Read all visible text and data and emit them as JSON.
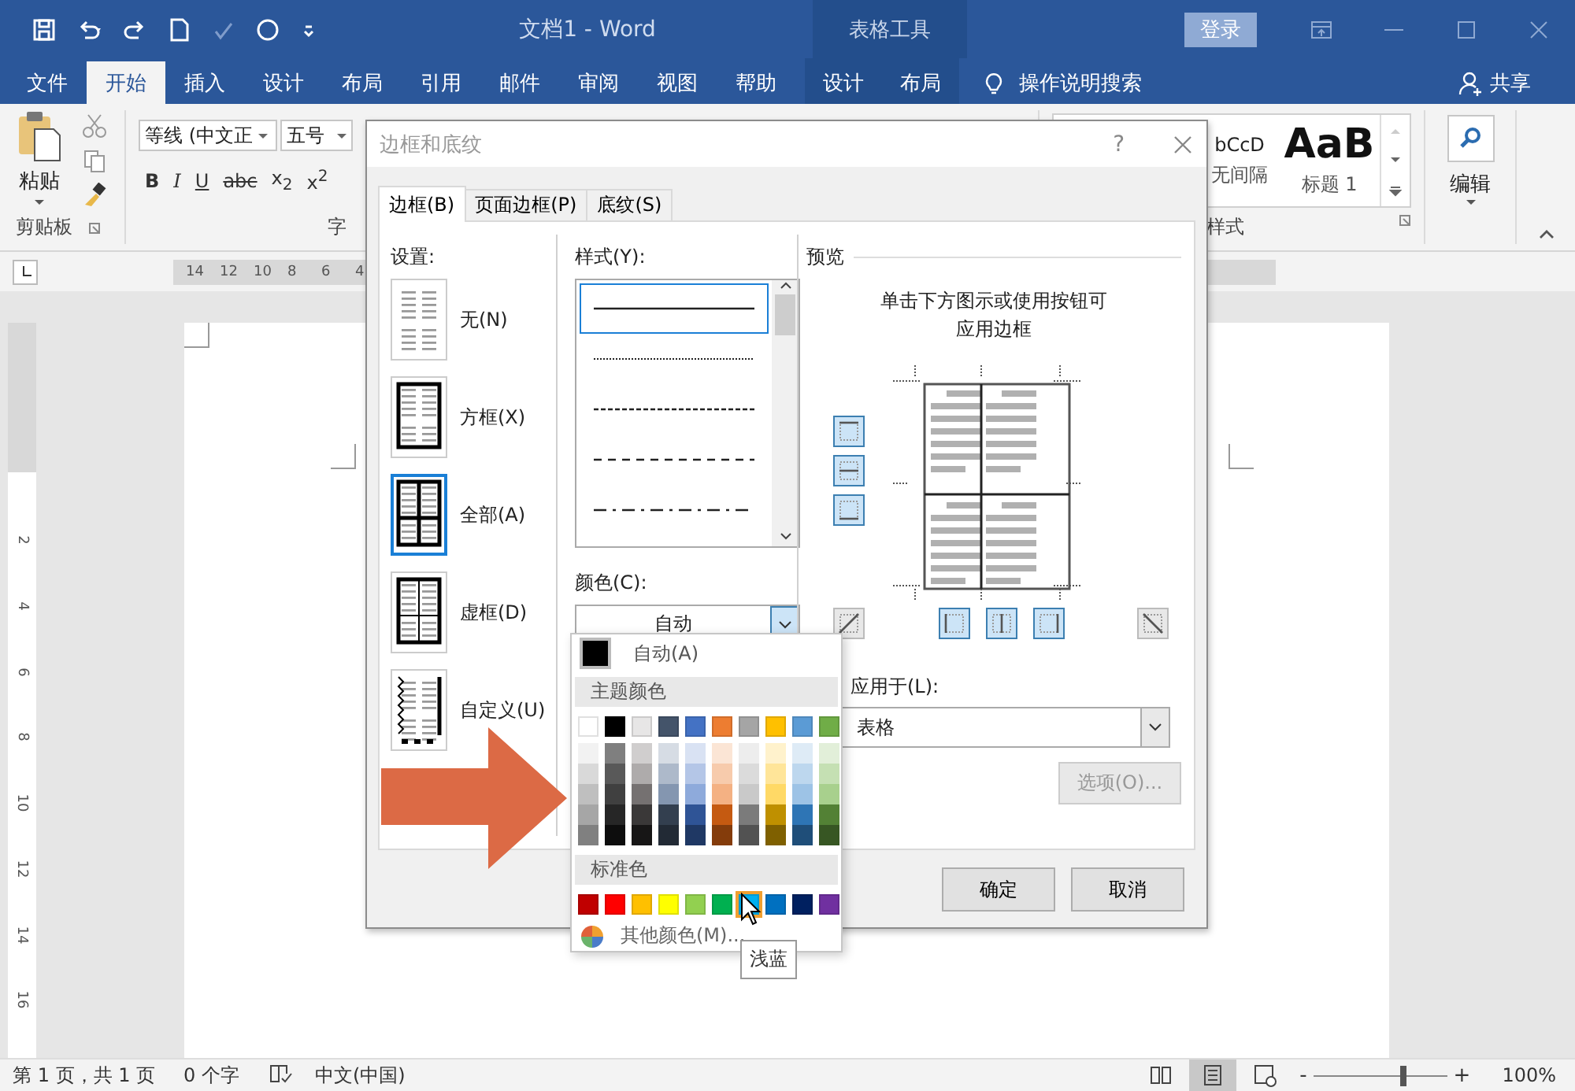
{
  "window": {
    "title": "文档1 - Word",
    "context_group": "表格工具",
    "sign_in": "登录"
  },
  "ribbon_tabs": [
    {
      "label": "文件",
      "selected": false
    },
    {
      "label": "开始",
      "selected": true
    },
    {
      "label": "插入",
      "selected": false
    },
    {
      "label": "设计",
      "selected": false
    },
    {
      "label": "布局",
      "selected": false
    },
    {
      "label": "引用",
      "selected": false
    },
    {
      "label": "邮件",
      "selected": false
    },
    {
      "label": "审阅",
      "selected": false
    },
    {
      "label": "视图",
      "selected": false
    },
    {
      "label": "帮助",
      "selected": false
    }
  ],
  "context_tabs": [
    {
      "label": "设计",
      "selected": false
    },
    {
      "label": "布局",
      "selected": false
    }
  ],
  "tell_me": "操作说明搜索",
  "share": "共享",
  "clipboard": {
    "paste": "粘贴",
    "group": "剪贴板"
  },
  "font": {
    "name": "等线 (中文正",
    "size": "五号",
    "group": "字",
    "buttons": [
      {
        "kind": "bold",
        "label": "B"
      },
      {
        "kind": "italic",
        "label": "I"
      },
      {
        "kind": "underline",
        "label": "U"
      },
      {
        "kind": "strike",
        "label": "abc"
      },
      {
        "kind": "script",
        "label": "x$_{2}$"
      },
      {
        "kind": "script",
        "label": "x$^{2}$"
      }
    ]
  },
  "styles": {
    "items": [
      {
        "preview": "bCcD",
        "label": "无间隔",
        "kind": "normal"
      },
      {
        "preview": "AaB",
        "label": "标题 1",
        "kind": "heading"
      }
    ],
    "group": "样式"
  },
  "editing": {
    "label": "编辑"
  },
  "ruler": {
    "labels": [
      "14",
      "12",
      "10",
      "8",
      "6",
      "4"
    ]
  },
  "vertical_ruler": {
    "labels": [
      "2",
      "4",
      "6",
      "8",
      "10",
      "12",
      "14",
      "16"
    ]
  },
  "dialog": {
    "title": "边框和底纹",
    "help": "?",
    "tabs": [
      {
        "label": "边框(B)",
        "selected": true
      },
      {
        "label": "页面边框(P)",
        "selected": false
      },
      {
        "label": "底纹(S)",
        "selected": false
      }
    ],
    "settings_label": "设置:",
    "settings": [
      {
        "kind": "none",
        "label": "无(N)",
        "selected": false
      },
      {
        "kind": "box",
        "label": "方框(X)",
        "selected": false
      },
      {
        "kind": "all",
        "label": "全部(A)",
        "selected": true
      },
      {
        "kind": "grid",
        "label": "虚框(D)",
        "selected": false
      },
      {
        "kind": "custom",
        "label": "自定义(U)",
        "selected": false
      }
    ],
    "style_label": "样式(Y):",
    "line_styles": [
      {
        "kind": "solid",
        "selected": true
      },
      {
        "kind": "dotted",
        "selected": false
      },
      {
        "kind": "dashed-fine",
        "selected": false
      },
      {
        "kind": "dashed",
        "selected": false
      },
      {
        "kind": "dash-dot",
        "selected": false
      }
    ],
    "color_label": "颜色(C):",
    "color_value": "自动",
    "preview_label": "预览",
    "preview_hint": "单击下方图示或使用按钮可应用边框",
    "side_buttons": [
      {
        "kind": "top",
        "selected": true
      },
      {
        "kind": "inside-h",
        "selected": true
      },
      {
        "kind": "bottom",
        "selected": true
      }
    ],
    "bottom_buttons": [
      {
        "kind": "diag-up",
        "selected": false
      },
      {
        "kind": "left",
        "selected": true
      },
      {
        "kind": "inside-v",
        "selected": true
      },
      {
        "kind": "right",
        "selected": true
      },
      {
        "kind": "diag-down",
        "selected": false
      }
    ],
    "apply_label": "应用于(L):",
    "apply_value": "表格",
    "options": "选项(O)...",
    "options_disabled": true,
    "ok": "确定",
    "cancel": "取消"
  },
  "color_menu": {
    "auto": "自动(A)",
    "theme_header": "主题颜色",
    "theme_colors": [
      {
        "color": "#ffffff",
        "shades": [
          {
            "color": "#f2f2f2"
          },
          {
            "color": "#d9d9d9"
          },
          {
            "color": "#bfbfbf"
          },
          {
            "color": "#a6a6a6"
          },
          {
            "color": "#808080"
          }
        ]
      },
      {
        "color": "#000000",
        "shades": [
          {
            "color": "#7f7f7f"
          },
          {
            "color": "#595959"
          },
          {
            "color": "#404040"
          },
          {
            "color": "#262626"
          },
          {
            "color": "#0d0d0d"
          }
        ]
      },
      {
        "color": "#e7e6e6",
        "shades": [
          {
            "color": "#d0cece"
          },
          {
            "color": "#aeabab"
          },
          {
            "color": "#757171"
          },
          {
            "color": "#3a3838"
          },
          {
            "color": "#171616"
          }
        ]
      },
      {
        "color": "#44546a",
        "shades": [
          {
            "color": "#d6dce4"
          },
          {
            "color": "#adb9ca"
          },
          {
            "color": "#8496b0"
          },
          {
            "color": "#333f4f"
          },
          {
            "color": "#222a35"
          }
        ]
      },
      {
        "color": "#4472c4",
        "shades": [
          {
            "color": "#d9e2f3"
          },
          {
            "color": "#b4c6e7"
          },
          {
            "color": "#8eaadb"
          },
          {
            "color": "#2f5496"
          },
          {
            "color": "#1f3864"
          }
        ]
      },
      {
        "color": "#ed7d31",
        "shades": [
          {
            "color": "#fbe5d5"
          },
          {
            "color": "#f7cbac"
          },
          {
            "color": "#f4b183"
          },
          {
            "color": "#c55a11"
          },
          {
            "color": "#843c0b"
          }
        ]
      },
      {
        "color": "#a5a5a5",
        "shades": [
          {
            "color": "#ededed"
          },
          {
            "color": "#dbdbdb"
          },
          {
            "color": "#c9c9c9"
          },
          {
            "color": "#7b7b7b"
          },
          {
            "color": "#525252"
          }
        ]
      },
      {
        "color": "#ffc000",
        "shades": [
          {
            "color": "#fff2cc"
          },
          {
            "color": "#ffe599"
          },
          {
            "color": "#ffd966"
          },
          {
            "color": "#bf9000"
          },
          {
            "color": "#7f6000"
          }
        ]
      },
      {
        "color": "#5b9bd5",
        "shades": [
          {
            "color": "#deebf6"
          },
          {
            "color": "#bdd7ee"
          },
          {
            "color": "#9dc3e6"
          },
          {
            "color": "#2e75b5"
          },
          {
            "color": "#1f4e79"
          }
        ]
      },
      {
        "color": "#70ad47",
        "shades": [
          {
            "color": "#e2efd9"
          },
          {
            "color": "#c5e0b3"
          },
          {
            "color": "#a8d08d"
          },
          {
            "color": "#538135"
          },
          {
            "color": "#375623"
          }
        ]
      }
    ],
    "standard_header": "标准色",
    "standard_colors": [
      {
        "color": "#c00000",
        "selected": false
      },
      {
        "color": "#ff0000",
        "selected": false
      },
      {
        "color": "#ffc000",
        "selected": false
      },
      {
        "color": "#ffff00",
        "selected": false
      },
      {
        "color": "#92d050",
        "selected": false
      },
      {
        "color": "#00b050",
        "selected": false
      },
      {
        "color": "#00b0f0",
        "selected": true
      },
      {
        "color": "#0070c0",
        "selected": false
      },
      {
        "color": "#002060",
        "selected": false
      },
      {
        "color": "#7030a0",
        "selected": false
      }
    ],
    "more": "其他颜色(M)...",
    "tooltip": "浅蓝"
  },
  "status_bar": {
    "page": "第 1 页，共 1 页",
    "words": "0 个字",
    "language": "中文(中国)",
    "views": [
      {
        "kind": "read",
        "selected": false
      },
      {
        "kind": "print",
        "selected": true
      },
      {
        "kind": "web",
        "selected": false
      }
    ],
    "zoom_out": "-",
    "zoom_slider": {
      "level": 0.67
    },
    "zoom_in": "+",
    "zoom": "100%"
  }
}
